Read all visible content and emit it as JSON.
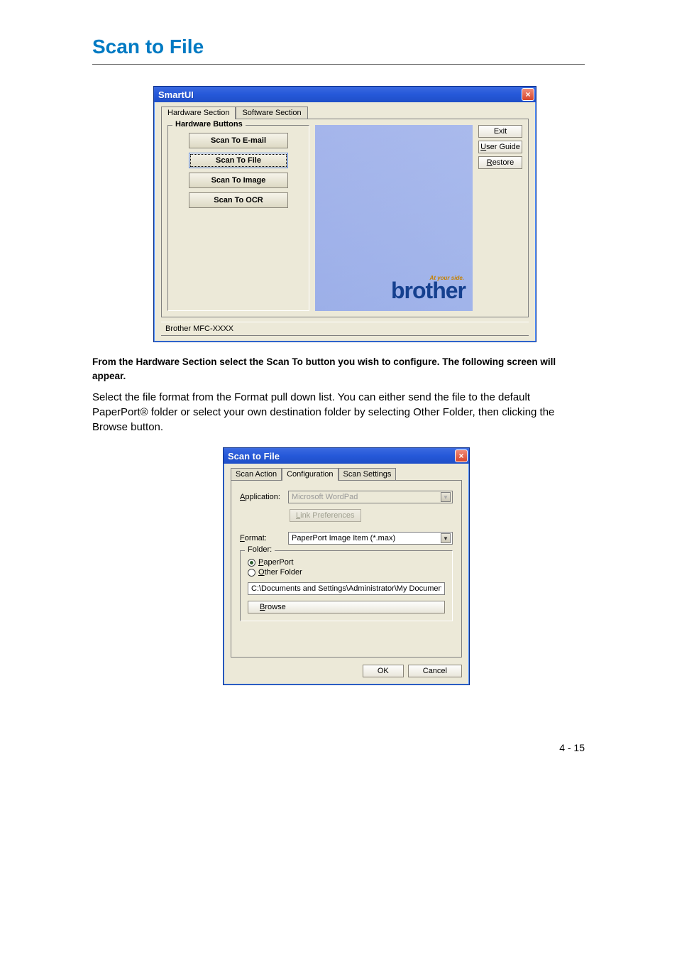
{
  "section": {
    "title": "Scan to File"
  },
  "para1": "From the Hardware Section select the Scan To button you wish to configure. The following screen will appear.",
  "para2": "Select the file format from the Format pull down list. You can either send the file to the default PaperPort® folder or select your own destination folder by selecting Other Folder, then clicking the Browse button.",
  "smartui": {
    "title": "SmartUI",
    "tabs": [
      "Hardware Section",
      "Software Section"
    ],
    "group_title": "Hardware Buttons",
    "buttons": [
      "Scan To E-mail",
      "Scan To File",
      "Scan To Image",
      "Scan To OCR"
    ],
    "side": {
      "exit": "Exit",
      "userguide": "ser Guide",
      "userguide_u": "U",
      "restore": "estore",
      "restore_u": "R"
    },
    "brother_tag": "At your side.",
    "brother_logo": "brother",
    "status": "Brother MFC-XXXX"
  },
  "dlg": {
    "title": "Scan to File",
    "tabs": [
      "Scan Action",
      "Configuration",
      "Scan Settings"
    ],
    "app_label": "pplication:",
    "app_label_u": "A",
    "app_value": "Microsoft WordPad",
    "link_pref": "ink Preferences",
    "link_pref_u": "L",
    "format_label": "ormat:",
    "format_label_u": "F",
    "format_value": "PaperPort Image Item (*.max)",
    "folder_label": "Folder:",
    "radio_paperport": "aperPort",
    "radio_paperport_u": "P",
    "radio_other": "ther Folder",
    "radio_other_u": "O",
    "path": "C:\\Documents and Settings\\Administrator\\My Documents\\M",
    "browse": "rowse",
    "browse_u": "B",
    "ok": "OK",
    "cancel": "Cancel"
  },
  "page_number": "4 - 15"
}
